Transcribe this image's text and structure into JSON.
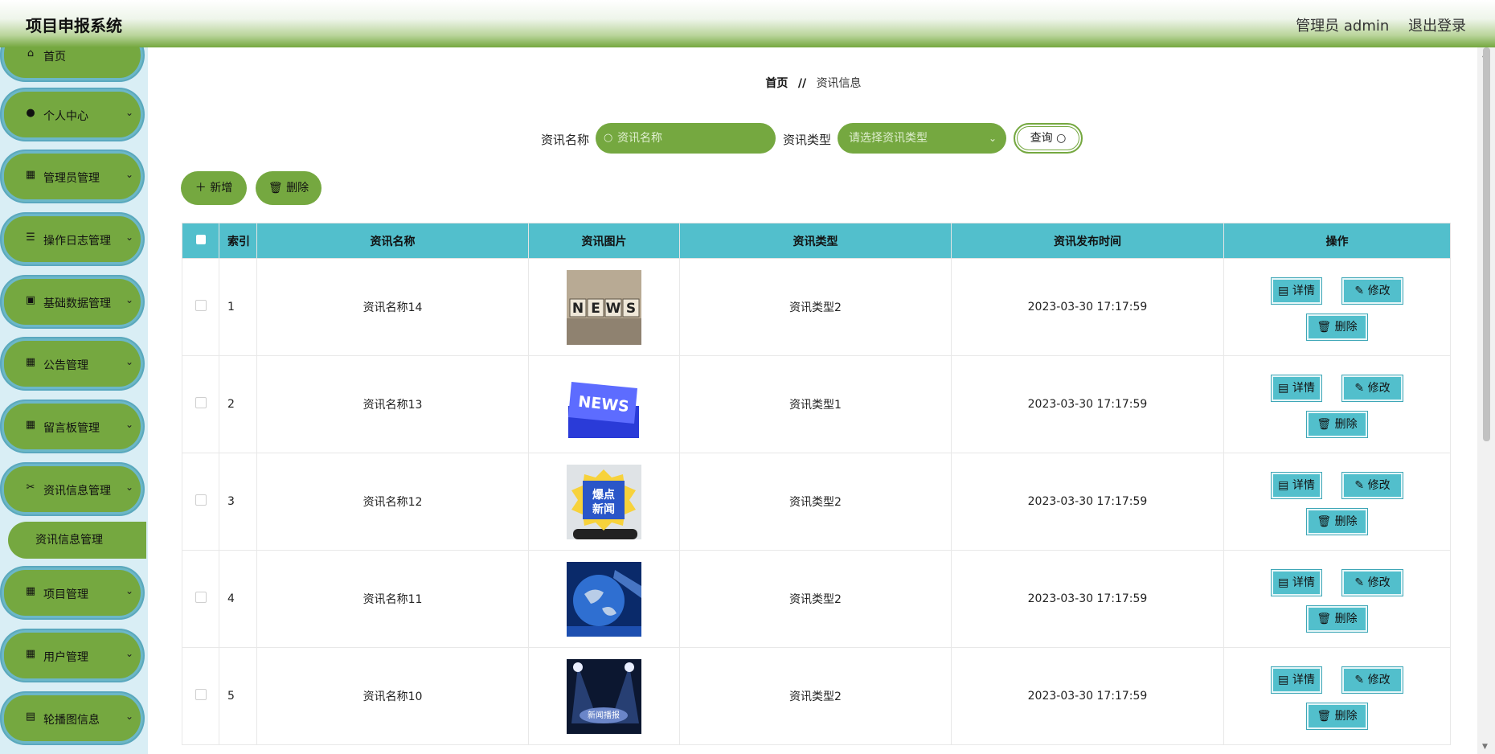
{
  "header": {
    "title": "项目申报系统",
    "user": "管理员 admin",
    "logout": "退出登录"
  },
  "sidebar": {
    "items": [
      {
        "label": "首页",
        "icon": "home-icon"
      },
      {
        "label": "个人中心",
        "icon": "user-icon"
      },
      {
        "label": "管理员管理",
        "icon": "grid-icon"
      },
      {
        "label": "操作日志管理",
        "icon": "sliders-icon"
      },
      {
        "label": "基础数据管理",
        "icon": "clipboard-icon"
      },
      {
        "label": "公告管理",
        "icon": "grid-icon"
      },
      {
        "label": "留言板管理",
        "icon": "grid-icon"
      },
      {
        "label": "资讯信息管理",
        "icon": "ticket-icon"
      },
      {
        "label": "项目管理",
        "icon": "grid-icon"
      },
      {
        "label": "用户管理",
        "icon": "grid-icon"
      },
      {
        "label": "轮播图信息",
        "icon": "chart-icon"
      }
    ],
    "sub_item": "资讯信息管理"
  },
  "breadcrumb": {
    "home": "首页",
    "sep": "//",
    "current": "资讯信息"
  },
  "search": {
    "name_label": "资讯名称",
    "name_placeholder": "资讯名称",
    "type_label": "资讯类型",
    "type_placeholder": "请选择资讯类型",
    "query_label": "查询"
  },
  "actions": {
    "add": "新增",
    "delete": "删除"
  },
  "table": {
    "headers": [
      "索引",
      "资讯名称",
      "资讯图片",
      "资讯类型",
      "资讯发布时间",
      "操作"
    ],
    "rows": [
      {
        "index": "1",
        "name": "资讯名称14",
        "type": "资讯类型2",
        "time": "2023-03-30 17:17:59",
        "image": "NEWS",
        "img_style": "dice"
      },
      {
        "index": "2",
        "name": "资讯名称13",
        "type": "资讯类型1",
        "time": "2023-03-30 17:17:59",
        "image": "NEWS",
        "img_style": "key"
      },
      {
        "index": "3",
        "name": "资讯名称12",
        "type": "资讯类型2",
        "time": "2023-03-30 17:17:59",
        "image": "爆点\n新闻",
        "img_style": "badge"
      },
      {
        "index": "4",
        "name": "资讯名称11",
        "type": "资讯类型2",
        "time": "2023-03-30 17:17:59",
        "image": "",
        "img_style": "globe"
      },
      {
        "index": "5",
        "name": "资讯名称10",
        "type": "资讯类型2",
        "time": "2023-03-30 17:17:59",
        "image": "新闻播报",
        "img_style": "stage"
      }
    ],
    "ops": {
      "detail": "详情",
      "edit": "修改",
      "delete": "删除"
    }
  },
  "colors": {
    "accent_green": "#75a840",
    "teal": "#52bfcc",
    "sidebar_bg": "#d9eef5"
  }
}
